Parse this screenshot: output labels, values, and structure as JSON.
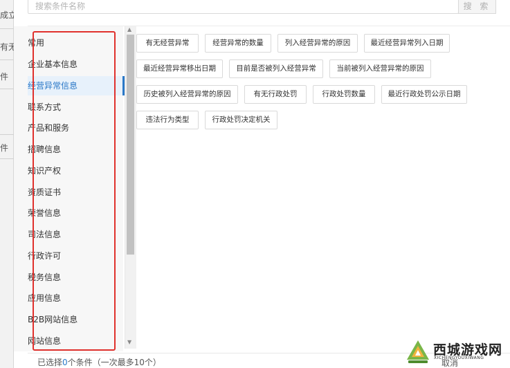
{
  "background_page": {
    "fragments": [
      "成立",
      "有无",
      "件",
      "件"
    ]
  },
  "search": {
    "placeholder": "搜索条件名称",
    "button_label": "搜 索"
  },
  "categories": [
    {
      "label": "常用"
    },
    {
      "label": "企业基本信息"
    },
    {
      "label": "经营异常信息",
      "active": true
    },
    {
      "label": "联系方式"
    },
    {
      "label": "产品和服务"
    },
    {
      "label": "招聘信息"
    },
    {
      "label": "知识产权"
    },
    {
      "label": "资质证书"
    },
    {
      "label": "荣誉信息"
    },
    {
      "label": "司法信息"
    },
    {
      "label": "行政许可"
    },
    {
      "label": "税务信息"
    },
    {
      "label": "应用信息"
    },
    {
      "label": "B2B网站信息"
    },
    {
      "label": "网站信息"
    }
  ],
  "tags": [
    "有无经营异常",
    "经营异常的数量",
    "列入经营异常的原因",
    "最近经营异常列入日期",
    "最近经营异常移出日期",
    "目前是否被列入经营异常",
    "当前被列入经营异常的原因",
    "历史被列入经营异常的原因",
    "有无行政处罚",
    "行政处罚数量",
    "最近行政处罚公示日期",
    "违法行为类型",
    "行政处罚决定机关"
  ],
  "footer": {
    "selected_prefix": "已选择",
    "selected_count": "0",
    "selected_suffix": "个条件（一次最多10个）",
    "cancel_label": "取消"
  },
  "watermark": {
    "name": "西城游戏网",
    "domain": "XICHENGYOUXIWANG"
  },
  "colors": {
    "accent": "#2a78c7",
    "highlight_box": "#e0302c",
    "active_bg": "#e7f1fb"
  }
}
